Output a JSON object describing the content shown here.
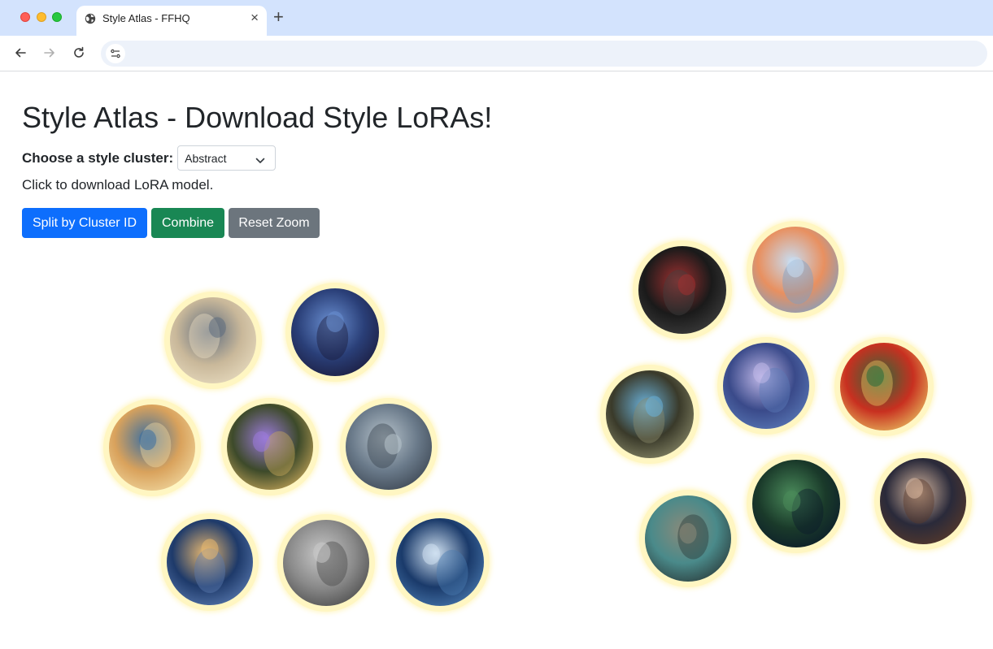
{
  "browser": {
    "tab_title": "Style Atlas - FFHQ",
    "tab_icon": "globe-icon",
    "close_glyph": "×",
    "new_tab_glyph": "+"
  },
  "page": {
    "title": "Style Atlas - Download Style LoRAs!",
    "cluster_label": "Choose a style cluster:",
    "cluster_selected": "Abstract",
    "helper_text": "Click to download LoRA model.",
    "buttons": {
      "split": "Split by Cluster ID",
      "combine": "Combine",
      "reset": "Reset Zoom"
    },
    "colors": {
      "primary": "#0d6efd",
      "success": "#198754",
      "secondary": "#6c757d",
      "bubble_ring": "#fff6c2"
    }
  },
  "thumbnails": [
    {
      "name": "thumb-golden-goddess",
      "palette": [
        "#c9b89a",
        "#5d6b7e",
        "#e8dcc0"
      ]
    },
    {
      "name": "thumb-blue-hair-woman",
      "palette": [
        "#2a3f78",
        "#6a8fd1",
        "#1a1a3a"
      ]
    },
    {
      "name": "thumb-profile-woman-waves",
      "palette": [
        "#d9a25c",
        "#3a6ea0",
        "#f0d8a0"
      ]
    },
    {
      "name": "thumb-ornate-portal",
      "palette": [
        "#3d4a2a",
        "#9a7ad8",
        "#c8a85a"
      ]
    },
    {
      "name": "thumb-misty-figure",
      "palette": [
        "#6a7a8a",
        "#b8c4cc",
        "#3a4450"
      ]
    },
    {
      "name": "thumb-child-on-cloud",
      "palette": [
        "#1e3a6a",
        "#e8b870",
        "#5a7ab0"
      ]
    },
    {
      "name": "thumb-grayscale-sketch",
      "palette": [
        "#8a8a8a",
        "#c8c8c8",
        "#4a4a4a"
      ]
    },
    {
      "name": "thumb-ocean-wave",
      "palette": [
        "#1a3a6a",
        "#cfe0f0",
        "#4a7ab0"
      ]
    },
    {
      "name": "thumb-hooded-dark-figure",
      "palette": [
        "#1a1a1a",
        "#a03030",
        "#404040"
      ]
    },
    {
      "name": "thumb-ice-princess",
      "palette": [
        "#e89060",
        "#c8dcf0",
        "#7aa0c8"
      ]
    },
    {
      "name": "thumb-mushroom-fantasy",
      "palette": [
        "#3a4a8a",
        "#c0b8e8",
        "#5a7ab8"
      ]
    },
    {
      "name": "thumb-red-tree",
      "palette": [
        "#c83020",
        "#2a6a3a",
        "#e8c060"
      ]
    },
    {
      "name": "thumb-light-tunnel",
      "palette": [
        "#3a3a2a",
        "#6ab0d8",
        "#8a8a6a"
      ]
    },
    {
      "name": "thumb-robot-machine",
      "palette": [
        "#4a8a8a",
        "#8a8a7a",
        "#2a3a3a"
      ]
    },
    {
      "name": "thumb-night-rooftop",
      "palette": [
        "#1a3a2a",
        "#4a8a5a",
        "#0a1a2a"
      ]
    },
    {
      "name": "thumb-dark-hair-woman",
      "palette": [
        "#2a2a3a",
        "#d8b8a0",
        "#5a3a2a"
      ]
    }
  ]
}
